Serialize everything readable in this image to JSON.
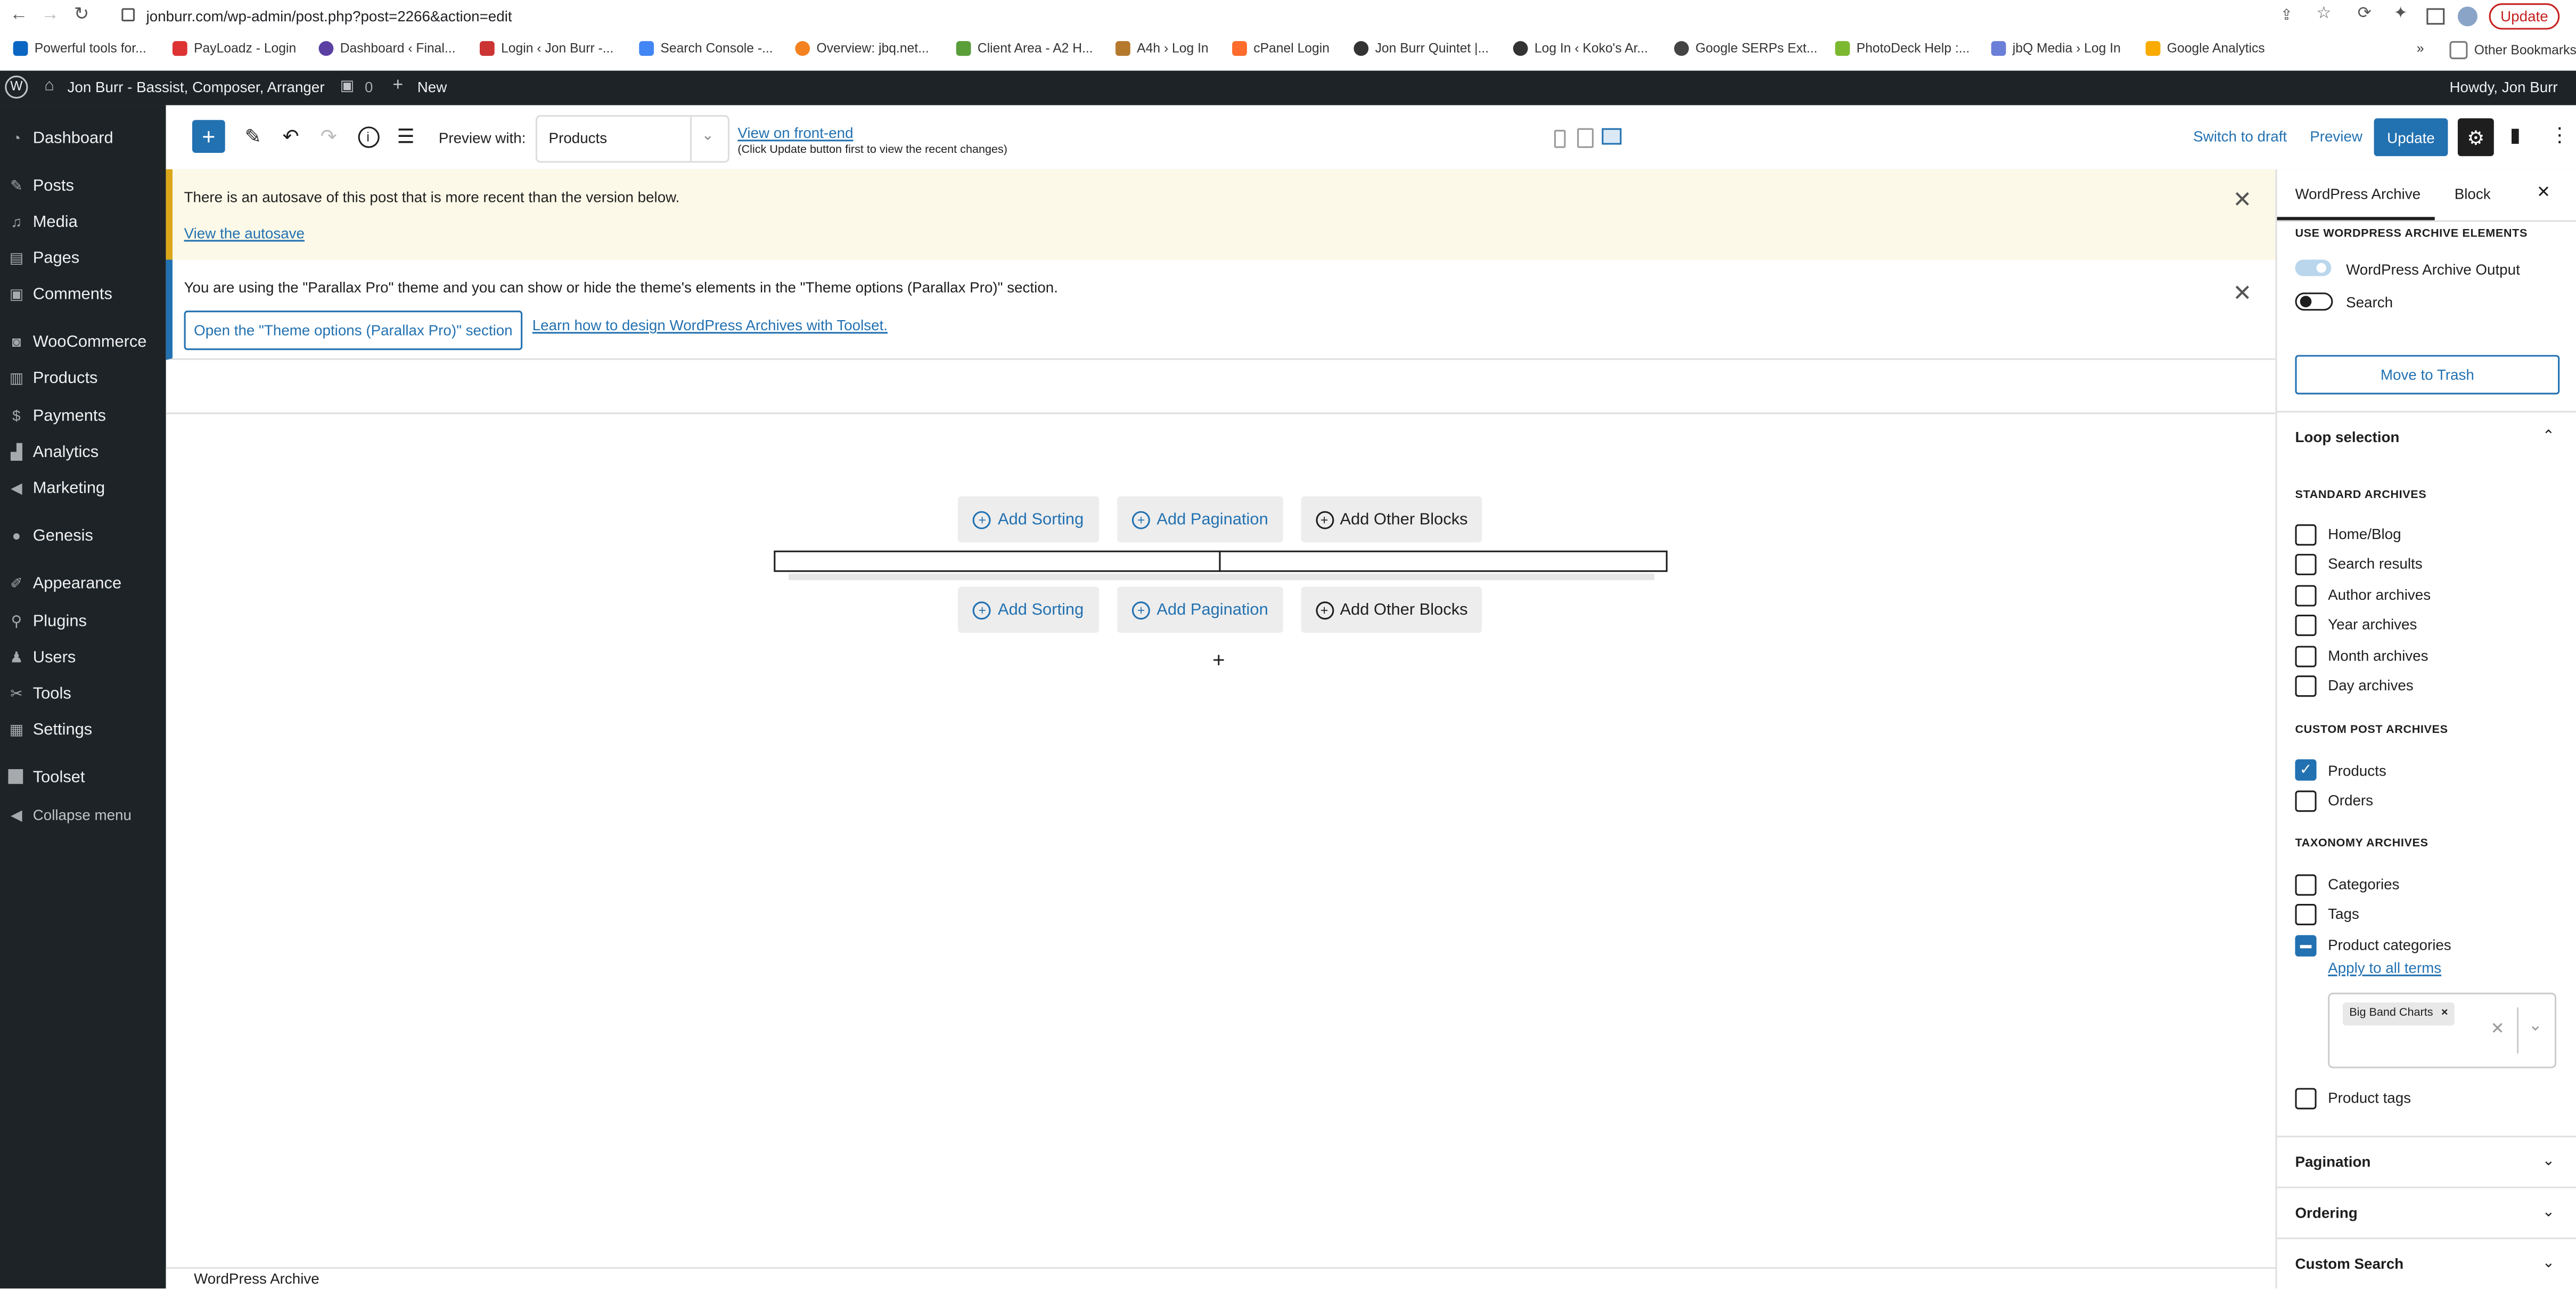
{
  "browser": {
    "url": "jonburr.com/wp-admin/post.php?post=2266&action=edit",
    "update_label": "Update",
    "bookmarks": [
      "Powerful tools for...",
      "PayLoadz - Login",
      "Dashboard ‹ Final...",
      "Login ‹ Jon Burr -...",
      "Search Console -...",
      "Overview: jbq.net...",
      "Client Area - A2 H...",
      "A4h › Log In",
      "cPanel Login",
      "Jon Burr Quintet |...",
      "Log In ‹ Koko's Ar...",
      "Google SERPs Ext...",
      "PhotoDeck Help :...",
      "jbQ Media › Log In",
      "Google Analytics"
    ],
    "more_bookmarks": "»",
    "other_bookmarks": "Other Bookmarks"
  },
  "adminbar": {
    "site_name": "Jon Burr - Bassist, Composer, Arranger",
    "comments_count": "0",
    "new_label": "New",
    "greeting": "Howdy, Jon Burr"
  },
  "sidebar": {
    "items": [
      {
        "label": "Dashboard",
        "icon": "dashboard-icon"
      },
      {
        "label": "Posts",
        "icon": "pin-icon"
      },
      {
        "label": "Media",
        "icon": "media-icon"
      },
      {
        "label": "Pages",
        "icon": "pages-icon"
      },
      {
        "label": "Comments",
        "icon": "comment-icon"
      },
      {
        "label": "WooCommerce",
        "icon": "woo-icon"
      },
      {
        "label": "Products",
        "icon": "archive-icon"
      },
      {
        "label": "Payments",
        "icon": "payments-icon"
      },
      {
        "label": "Analytics",
        "icon": "chart-icon"
      },
      {
        "label": "Marketing",
        "icon": "megaphone-icon"
      },
      {
        "label": "Genesis",
        "icon": "genesis-icon"
      },
      {
        "label": "Appearance",
        "icon": "brush-icon"
      },
      {
        "label": "Plugins",
        "icon": "plugin-icon"
      },
      {
        "label": "Users",
        "icon": "user-icon"
      },
      {
        "label": "Tools",
        "icon": "wrench-icon"
      },
      {
        "label": "Settings",
        "icon": "settings-icon"
      },
      {
        "label": "Toolset",
        "icon": "toolset-icon"
      },
      {
        "label": "Collapse menu",
        "icon": "collapse-icon"
      }
    ]
  },
  "toolbar": {
    "preview_with_label": "Preview with:",
    "preview_select_value": "Products",
    "view_frontend": "View on front-end",
    "view_frontend_note": "(Click Update button first to view the recent changes)",
    "switch_to_draft": "Switch to draft",
    "preview": "Preview",
    "update": "Update"
  },
  "notices": {
    "autosave_text": "There is an autosave of this post that is more recent than the version below.",
    "autosave_link": "View the autosave",
    "theme_text": "You are using the \"Parallax Pro\" theme and you can show or hide the theme's elements in the \"Theme options (Parallax Pro)\" section.",
    "theme_button": "Open the \"Theme options (Parallax Pro)\" section",
    "theme_link": "Learn how to design WordPress Archives with Toolset."
  },
  "canvas": {
    "add_sorting": "Add Sorting",
    "add_pagination": "Add Pagination",
    "add_other_blocks": "Add Other Blocks",
    "add_block_symbol": "+"
  },
  "panel": {
    "tab_archive": "WordPress Archive",
    "tab_block": "Block",
    "elements_header": "USE WORDPRESS ARCHIVE ELEMENTS",
    "toggle_output": "WordPress Archive Output",
    "toggle_search": "Search",
    "move_to_trash": "Move to Trash",
    "loop_selection": "Loop selection",
    "standard_header": "STANDARD ARCHIVES",
    "standard": [
      {
        "label": "Home/Blog",
        "checked": false
      },
      {
        "label": "Search results",
        "checked": false
      },
      {
        "label": "Author archives",
        "checked": false
      },
      {
        "label": "Year archives",
        "checked": false
      },
      {
        "label": "Month archives",
        "checked": false
      },
      {
        "label": "Day archives",
        "checked": false
      }
    ],
    "custom_header": "CUSTOM POST ARCHIVES",
    "custom": [
      {
        "label": "Products",
        "checked": true
      },
      {
        "label": "Orders",
        "checked": false
      }
    ],
    "taxonomy_header": "TAXONOMY ARCHIVES",
    "taxonomy": [
      {
        "label": "Categories",
        "checked": false
      },
      {
        "label": "Tags",
        "checked": false
      },
      {
        "label": "Product categories",
        "checked": "partial"
      }
    ],
    "apply_to_all": "Apply to all terms",
    "term_tag": "Big Band Charts",
    "product_tags": "Product tags",
    "pagination": "Pagination",
    "ordering": "Ordering",
    "custom_search": "Custom Search"
  },
  "footer": {
    "breadcrumb": "WordPress Archive"
  },
  "colors": {
    "accent": "#2271b1",
    "admin_dark": "#1d2327",
    "notice_bg": "#fcf9e8",
    "notice_border": "#dba617"
  }
}
